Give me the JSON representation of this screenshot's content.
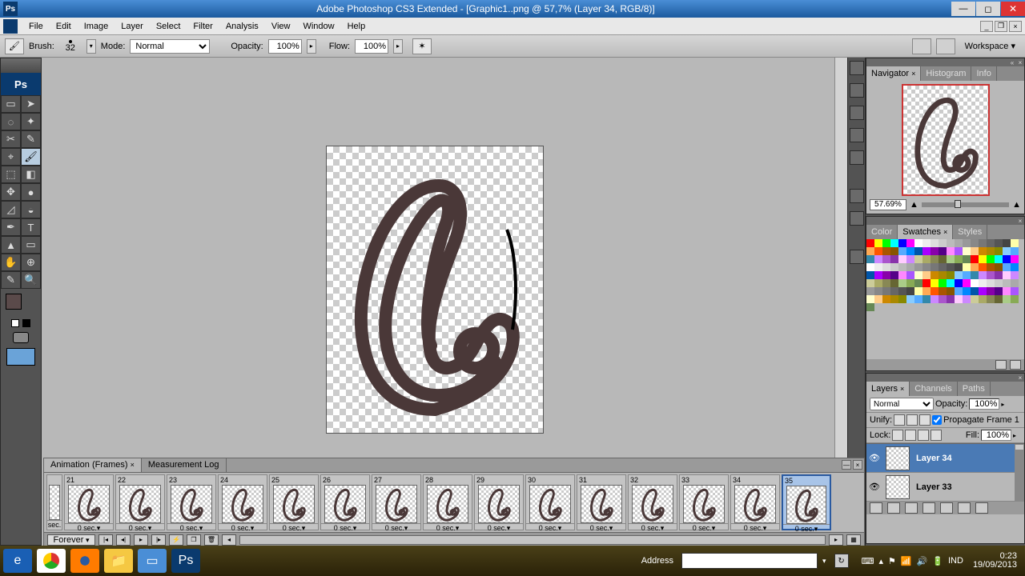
{
  "title": "Adobe Photoshop CS3 Extended - [Graphic1..png @ 57,7% (Layer 34, RGB/8)]",
  "menu": [
    "File",
    "Edit",
    "Image",
    "Layer",
    "Select",
    "Filter",
    "Analysis",
    "View",
    "Window",
    "Help"
  ],
  "options": {
    "brush_label": "Brush:",
    "brush_size": "32",
    "mode_label": "Mode:",
    "mode_value": "Normal",
    "opacity_label": "Opacity:",
    "opacity_value": "100%",
    "flow_label": "Flow:",
    "flow_value": "100%",
    "workspace": "Workspace"
  },
  "navigator": {
    "tab_nav": "Navigator",
    "tab_hist": "Histogram",
    "tab_info": "Info",
    "zoom": "57.69%"
  },
  "swatches": {
    "tab_color": "Color",
    "tab_swatches": "Swatches",
    "tab_styles": "Styles",
    "colors": [
      "#f00",
      "#ff0",
      "#0f0",
      "#0ff",
      "#00f",
      "#f0f",
      "#fff",
      "#eee",
      "#ddd",
      "#ccc",
      "#bbb",
      "#aaa",
      "#999",
      "#888",
      "#777",
      "#666",
      "#555",
      "#444",
      "#ffa",
      "#fa5",
      "#f50",
      "#a50",
      "#850",
      "#5af",
      "#08f",
      "#05a",
      "#a0f",
      "#80a",
      "#508",
      "#f8f",
      "#a5f",
      "#ffc",
      "#fc8",
      "#c80",
      "#a80",
      "#880",
      "#8cf",
      "#5af",
      "#38a",
      "#c8f",
      "#a5c",
      "#83a",
      "#fcf",
      "#c8f",
      "#cc9",
      "#aa6",
      "#885",
      "#663",
      "#ac8",
      "#8a5",
      "#685"
    ]
  },
  "layers": {
    "tab_layers": "Layers",
    "tab_channels": "Channels",
    "tab_paths": "Paths",
    "blend": "Normal",
    "opacity_label": "Opacity:",
    "opacity_value": "100%",
    "unify_label": "Unify:",
    "propagate_label": "Propagate Frame 1",
    "lock_label": "Lock:",
    "fill_label": "Fill:",
    "fill_value": "100%",
    "items": [
      {
        "name": "Layer 34",
        "selected": true
      },
      {
        "name": "Layer 33",
        "selected": false
      }
    ]
  },
  "animation": {
    "tab_anim": "Animation (Frames)",
    "tab_meas": "Measurement Log",
    "loop": "Forever",
    "delay_partial": "sec.",
    "frames": [
      {
        "n": "21",
        "d": "0 sec."
      },
      {
        "n": "22",
        "d": "0 sec."
      },
      {
        "n": "23",
        "d": "0 sec."
      },
      {
        "n": "24",
        "d": "0 sec."
      },
      {
        "n": "25",
        "d": "0 sec."
      },
      {
        "n": "26",
        "d": "0 sec."
      },
      {
        "n": "27",
        "d": "0 sec."
      },
      {
        "n": "28",
        "d": "0 sec."
      },
      {
        "n": "29",
        "d": "0 sec."
      },
      {
        "n": "30",
        "d": "0 sec."
      },
      {
        "n": "31",
        "d": "0 sec."
      },
      {
        "n": "32",
        "d": "0 sec."
      },
      {
        "n": "33",
        "d": "0 sec."
      },
      {
        "n": "34",
        "d": "0 sec."
      },
      {
        "n": "35",
        "d": "0 sec.",
        "selected": true
      }
    ]
  },
  "taskbar": {
    "address_label": "Address",
    "lang": "IND",
    "time": "0:23",
    "date": "19/09/2013"
  },
  "tool_glyphs": [
    "▭",
    "➤",
    "◌",
    "✦",
    "✂",
    "✎",
    "⌖",
    "🖌",
    "⬚",
    "◧",
    "✥",
    "●",
    "◿",
    "◒",
    "✒",
    "T",
    "▲",
    "▭",
    "✋",
    "⊕",
    "✎",
    "🔍"
  ]
}
